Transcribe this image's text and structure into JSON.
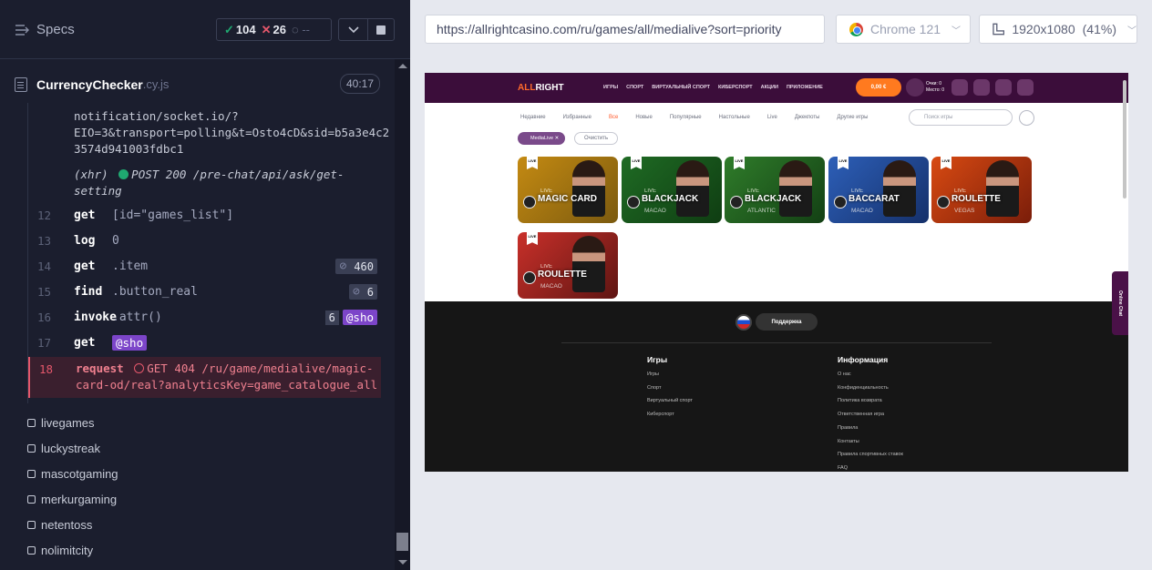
{
  "reporter": {
    "title": "Specs",
    "passed": "104",
    "failed": "26",
    "pending": "--",
    "spec": {
      "name": "CurrencyChecker",
      "ext": ".cy.js",
      "duration": "40:17"
    },
    "log_lines": [
      "notification/socket.io/?",
      "EIO=3&transport=polling&t=Osto4cD&sid=b5a3e4c2",
      "3574d941003fdbc1"
    ],
    "xhr": {
      "prefix": "(xhr)",
      "text": "POST 200 /pre-chat/api/ask/get-",
      "text2": "setting"
    },
    "commands": [
      {
        "num": "12",
        "cmd": "get",
        "arg": "[id=\"games_list\"]"
      },
      {
        "num": "13",
        "cmd": "log",
        "arg": "0"
      },
      {
        "num": "14",
        "cmd": "get",
        "arg": ".item",
        "count": "460"
      },
      {
        "num": "15",
        "cmd": "find",
        "arg": ".button_real",
        "count": "6"
      },
      {
        "num": "16",
        "cmd": "invoke",
        "arg": ".attr()",
        "count": "6",
        "alias": "@sho"
      },
      {
        "num": "17",
        "cmd": "get",
        "alias": "@sho"
      }
    ],
    "error": {
      "num": "18",
      "cmd": "request",
      "line1": "GET 404 /ru/game/medialive/magic-",
      "line2": "card-od/real?analyticsKey=game_catalogue_all"
    },
    "suites": [
      "livegames",
      "luckystreak",
      "mascotgaming",
      "merkurgaming",
      "netentoss",
      "nolimitcity"
    ]
  },
  "browser": {
    "url": "https://allrightcasino.com/ru/games/all/medialive?sort=priority",
    "name": "Chrome 121",
    "viewport": "1920x1080",
    "scale": "(41%)"
  },
  "site": {
    "logo_prefix": "ALL",
    "logo_suffix": "RIGHT",
    "nav": [
      "ИГРЫ",
      "СПОРТ",
      "ВИРТУАЛЬНЫЙ СПОРТ",
      "КИБЕРСПОРТ",
      "АКЦИИ",
      "ПРИЛОЖЕНИЕ"
    ],
    "balance": "0,00 €",
    "points_line1": "Очки: 0",
    "points_line2": "Место: 0",
    "categories": [
      "Недавние",
      "Избранные",
      "Все",
      "Новые",
      "Популярные",
      "Настольные",
      "Live",
      "Джекпоты",
      "Другие игры"
    ],
    "active_category": "Все",
    "search_placeholder": "Поиск игры",
    "chip": "MediaLive",
    "clear": "Очистить",
    "games": [
      {
        "live": "LIVE",
        "title": "MAGIC CARD",
        "sub": "",
        "bg": "linear-gradient(135deg,#c48a12,#7b5a0f)"
      },
      {
        "live": "LIVE",
        "title": "BLACKJACK",
        "sub": "MACAO",
        "bg": "linear-gradient(135deg,#1f6b24,#0f3d12)"
      },
      {
        "live": "LIVE",
        "title": "BLACKJACK",
        "sub": "ATLANTIC",
        "bg": "linear-gradient(135deg,#2f7c2a,#134014)"
      },
      {
        "live": "LIVE",
        "title": "BACCARAT",
        "sub": "MACAO",
        "bg": "linear-gradient(135deg,#2d5fb8,#15306a)"
      },
      {
        "live": "LIVE",
        "title": "ROULETTE",
        "sub": "VEGAS",
        "bg": "linear-gradient(135deg,#d84a12,#7a1d0a)"
      },
      {
        "live": "LIVE",
        "title": "ROULETTE",
        "sub": "MACAO",
        "bg": "linear-gradient(135deg,#c9302a,#5e1512)"
      }
    ],
    "support": "Поддержка",
    "footer_games_title": "Игры",
    "footer_games": [
      "Игры",
      "Спорт",
      "Виртуальный спорт",
      "Киберспорт"
    ],
    "footer_info_title": "Информация",
    "footer_info": [
      "О нас",
      "Конфиденциальность",
      "Политика возврата",
      "Ответственная игра",
      "Правила",
      "Контакты",
      "Правила спортивных ставок",
      "FAQ"
    ],
    "chat": "Online Chat"
  }
}
